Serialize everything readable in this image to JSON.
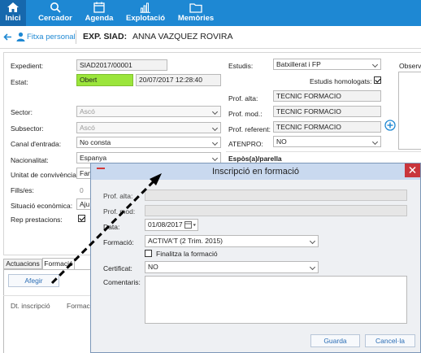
{
  "nav": {
    "items": [
      {
        "label": "Inici",
        "icon": "home-icon"
      },
      {
        "label": "Cercador",
        "icon": "search-icon"
      },
      {
        "label": "Agenda",
        "icon": "calendar-icon"
      },
      {
        "label": "Explotació",
        "icon": "bar-chart-icon"
      },
      {
        "label": "Memòries",
        "icon": "folder-icon"
      }
    ],
    "active_index": 0
  },
  "header": {
    "back_label": "Fitxa personal",
    "exp_label": "EXP. SIAD:",
    "person_name": "ANNA VAZQUEZ ROVIRA"
  },
  "form": {
    "expedient_label": "Expedient:",
    "expedient_value": "SIAD2017/00001",
    "estat_label": "Estat:",
    "estat_value": "Obert",
    "estat_datetime": "20/07/2017 12:28:40",
    "sector_label": "Sector:",
    "sector_value": "Ascó",
    "subsector_label": "Subsector:",
    "subsector_value": "Ascó",
    "canal_label": "Canal d'entrada:",
    "canal_value": "No consta",
    "nacionalitat_label": "Nacionalitat:",
    "nacionalitat_value": "Espanya",
    "unitat_label": "Unitat de convivència:",
    "unitat_value": "Fam",
    "fills_label": "Fills/es:",
    "fills_value": "0",
    "situacio_label": "Situació econòmica:",
    "situacio_value": "Aju",
    "rep_label": "Rep prestacions:",
    "estudis_label": "Estudis:",
    "estudis_value": "Batxillerat i FP",
    "homologats_label": "Estudis homologats:",
    "observa_label": "Observa",
    "prof_alta_label": "Prof. alta:",
    "prof_alta_value": "TECNIC FORMACIO",
    "prof_mod_label": "Prof. mod.:",
    "prof_mod_value": "TECNIC FORMACIO",
    "prof_ref_label": "Prof. referent:",
    "prof_ref_value": "TECNIC FORMACIO",
    "atenpro_label": "ATENPRO:",
    "atenpro_value": "NO",
    "espos_label": "Espòs(a)/parella"
  },
  "tabs": {
    "items": [
      "Actuacions",
      "Formació"
    ],
    "active_index": 1
  },
  "tab_panel": {
    "add_button": "Afegir",
    "col1": "Dt. inscripció",
    "col2": "Formaci"
  },
  "dialog": {
    "title": "Inscripció en formació",
    "prof_alta_label": "Prof. alta:",
    "prof_mod_label": "Prof. mod:",
    "data_label": "Data:",
    "data_value": "01/08/2017",
    "formacio_label": "Formació:",
    "formacio_value": "ACTIVA'T (2 Trim. 2015)",
    "finalitza_label": "Finalitza la formació",
    "certificat_label": "Certificat:",
    "certificat_value": "NO",
    "comentaris_label": "Comentaris:",
    "save_button": "Guarda",
    "cancel_button": "Cancel·la"
  },
  "colors": {
    "nav_bg": "#1e88d3",
    "nav_active": "#1668ad",
    "status_green": "#9be53b",
    "dialog_title_bg": "#c9d9ef",
    "close_red": "#c9353b",
    "link_blue": "#2a6db5"
  }
}
